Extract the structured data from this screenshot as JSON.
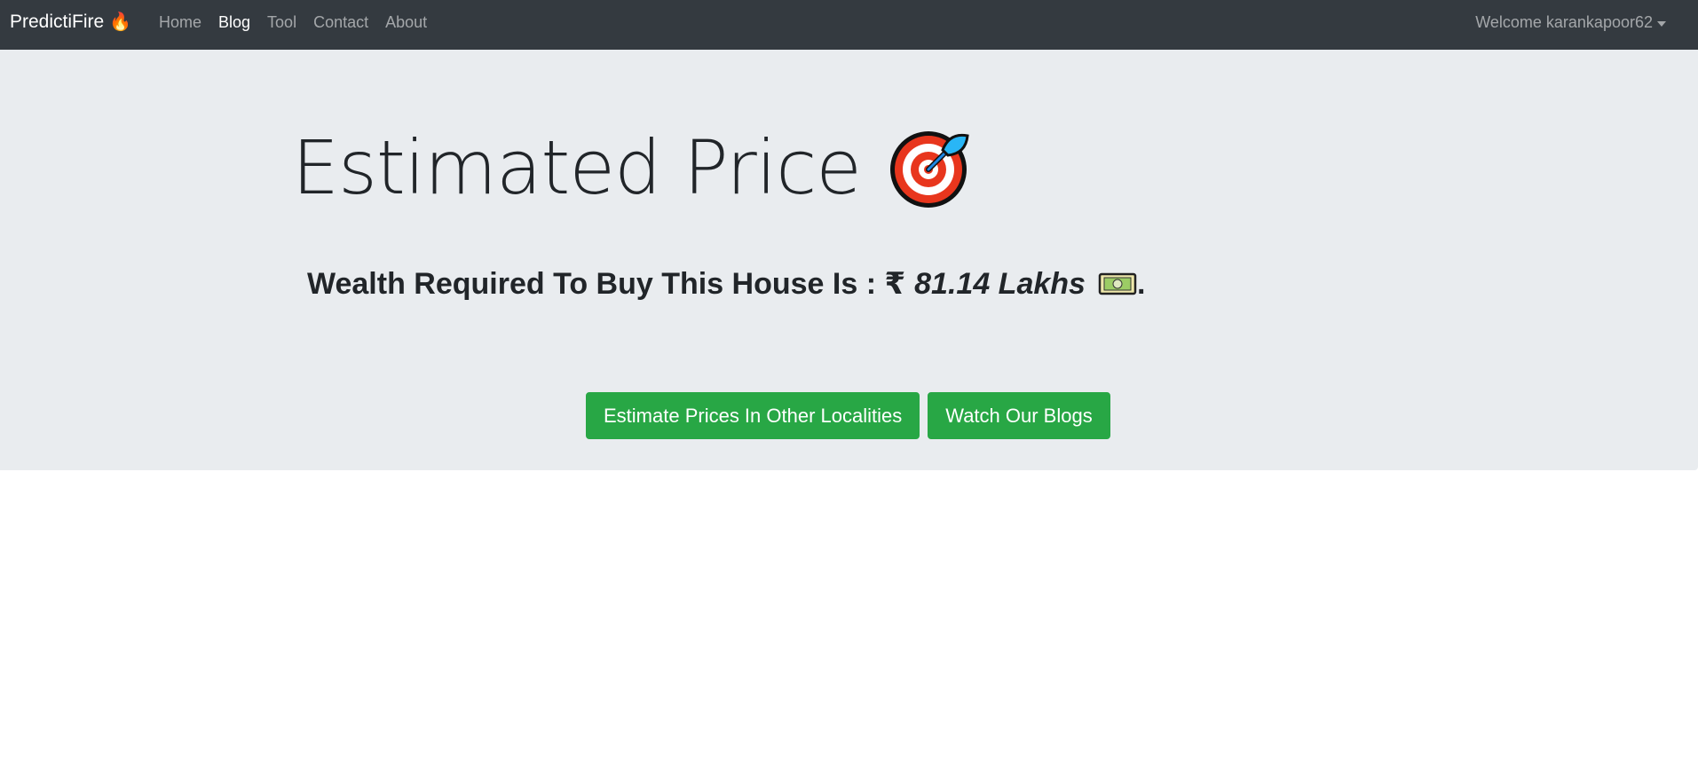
{
  "navbar": {
    "brand": "PredictiFire",
    "brand_icon": "🔥",
    "links": [
      {
        "label": "Home",
        "active": false
      },
      {
        "label": "Blog",
        "active": true
      },
      {
        "label": "Tool",
        "active": false
      },
      {
        "label": "Contact",
        "active": false
      },
      {
        "label": "About",
        "active": false
      }
    ],
    "user_menu": "Welcome karankapoor62"
  },
  "hero": {
    "title": "Estimated Price",
    "title_icon": "target-icon",
    "wealth_text": "Wealth Required To Buy This House Is : ₹",
    "amount": "81.14 Lakhs",
    "amount_icon": "money-icon",
    "period": ".",
    "buttons": {
      "estimate": "Estimate Prices In Other Localities",
      "blogs": "Watch Our Blogs"
    }
  },
  "colors": {
    "navbar_bg": "#343a40",
    "hero_bg": "#e9ecef",
    "button_green": "#28a745"
  }
}
